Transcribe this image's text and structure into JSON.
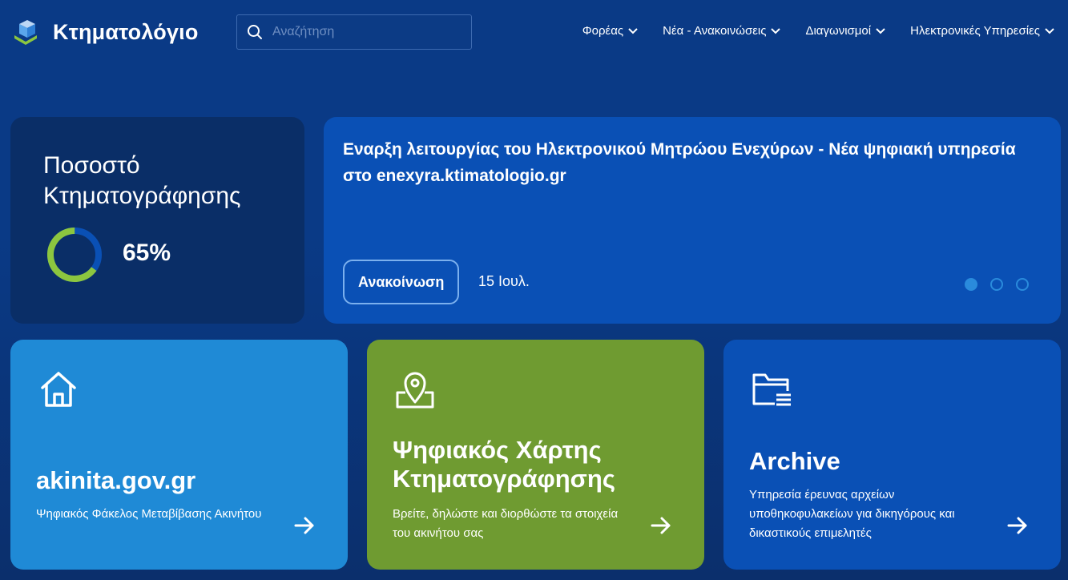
{
  "header": {
    "logo_text": "Κτηματολόγιο",
    "search_placeholder": "Αναζήτηση",
    "nav": [
      {
        "label": "Φορέας"
      },
      {
        "label": "Νέα - Ανακοινώσεις"
      },
      {
        "label": "Διαγωνισμοί"
      },
      {
        "label": "Ηλεκτρονικές Υπηρεσίες"
      }
    ]
  },
  "stat": {
    "title_line1": "Ποσοστό",
    "title_line2": "Κτηματογράφησης",
    "value_label": "65%",
    "progress_fraction": 0.65
  },
  "news": {
    "title": "Εναρξη λειτουργίας του Ηλεκτρονικού Μητρώου Ενεχύρων - Νέα ψηφιακή υπηρεσία στο enexyra.ktimatologio.gr",
    "badge": "Ανακοίνωση",
    "date": "15 Ιουλ.",
    "slides_total": 3,
    "active_slide": 1
  },
  "services": [
    {
      "title": "akinita.gov.gr",
      "desc": "Ψηφιακός Φάκελος Μεταβίβασης Ακινήτου",
      "icon": "home-icon"
    },
    {
      "title": "Ψηφιακός Χάρτης Κτηματογράφησης",
      "desc": "Βρείτε, δηλώστε και διορθώστε τα στοιχεία του ακινήτου σας",
      "icon": "map-pin-icon"
    },
    {
      "title": "Archive",
      "desc": "Υπηρεσία έρευνας αρχείων υποθηκοφυλακείων για δικηγόρους και δικαστικούς επιμελητές",
      "icon": "folder-list-icon"
    }
  ],
  "colors": {
    "background": "#0a3a86",
    "stat_card": "#0a2e67",
    "news_card": "#0a50b5",
    "card_blue": "#1f8ad6",
    "card_green": "#6f9b31",
    "donut_green": "#8cc63f",
    "donut_track": "#0a50b5"
  }
}
